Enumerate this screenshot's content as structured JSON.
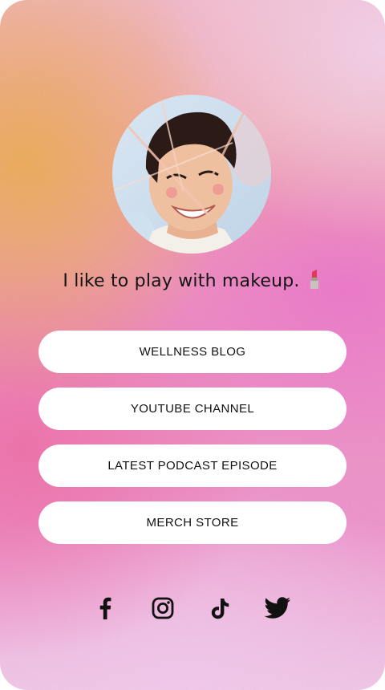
{
  "profile": {
    "bio": "I like to play with makeup.",
    "bio_emoji_icon": "lipstick-icon"
  },
  "links": [
    {
      "label": "WELLNESS BLOG"
    },
    {
      "label": "YOUTUBE CHANNEL"
    },
    {
      "label": "LATEST PODCAST EPISODE"
    },
    {
      "label": "MERCH STORE"
    }
  ],
  "social": [
    {
      "icon": "facebook-icon"
    },
    {
      "icon": "instagram-icon"
    },
    {
      "icon": "tiktok-icon"
    },
    {
      "icon": "twitter-icon"
    }
  ],
  "colors": {
    "button_bg": "#ffffff",
    "text": "#111111",
    "gradient_orange": "#eeaa50",
    "gradient_pink": "#ef6ea5",
    "gradient_light_pink": "#f4c8ec"
  }
}
